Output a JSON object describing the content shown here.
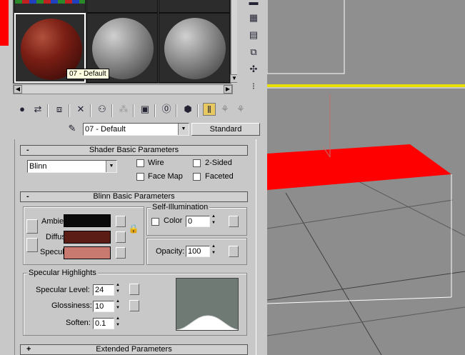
{
  "material_editor": {
    "tooltip": "07 - Default",
    "material_name": "07 - Default",
    "type_button": "Standard",
    "colors": {
      "selected_sphere": "#7a1e14",
      "grey_sphere": "#8a8a8a"
    }
  },
  "shader_basic": {
    "header": "Shader Basic Parameters",
    "toggle": "-",
    "shader": "Blinn",
    "wire": "Wire",
    "two_sided": "2-Sided",
    "face_map": "Face Map",
    "faceted": "Faceted"
  },
  "blinn_basic": {
    "header": "Blinn Basic Parameters",
    "toggle": "-",
    "ambient_label": "Ambient:",
    "diffuse_label": "Diffuse:",
    "specular_label": "Specular:",
    "ambient_color": "#0a0a0a",
    "diffuse_color": "#5a1c14",
    "specular_color": "#c87a70",
    "self_illum_title": "Self-Illumination",
    "color_label": "Color",
    "self_illum_value": "0",
    "opacity_label": "Opacity:",
    "opacity_value": "100"
  },
  "specular_highlights": {
    "title": "Specular Highlights",
    "level_label": "Specular Level:",
    "level_value": "24",
    "glossiness_label": "Glossiness:",
    "glossiness_value": "10",
    "soften_label": "Soften:",
    "soften_value": "0.1"
  },
  "extended": {
    "header": "Extended Parameters",
    "toggle": "+"
  },
  "viewport": {
    "object_color": "#ff0000"
  }
}
